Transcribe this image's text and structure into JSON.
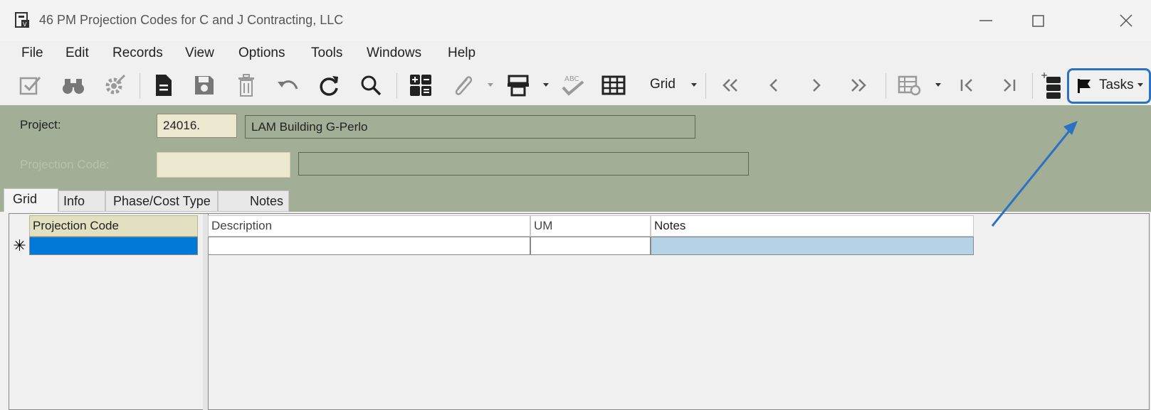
{
  "window": {
    "title": "46 PM Projection Codes for C and J Contracting, LLC",
    "controls": [
      "minimize",
      "maximize",
      "close"
    ]
  },
  "menu": [
    "File",
    "Edit",
    "Records",
    "View",
    "Options",
    "Tools",
    "Windows",
    "Help"
  ],
  "toolbar": {
    "grid_label": "Grid",
    "tasks_label": "Tasks",
    "icons": [
      "validate-icon",
      "binoculars-icon",
      "settings-icon",
      "new-document-icon",
      "save-icon",
      "delete-icon",
      "undo-icon",
      "refresh-icon",
      "search-icon",
      "calculator-icon",
      "attachment-icon",
      "print-icon",
      "spellcheck-icon",
      "grid-icon",
      "first-record-icon",
      "previous-record-icon",
      "next-record-icon",
      "last-record-icon",
      "form-settings-icon",
      "first-page-icon",
      "last-page-icon",
      "add-layer-icon",
      "flag-icon"
    ]
  },
  "header": {
    "project_label": "Project:",
    "project_value": "24016.",
    "project_description": "LAM Building G-Perlo",
    "projection_code_label": "Projection Code:",
    "projection_code_value": "",
    "projection_code_description": ""
  },
  "tabs": [
    "Grid",
    "Info",
    "Phase/Cost Type",
    "Notes"
  ],
  "grid": {
    "frozen_column": "Projection Code",
    "columns": [
      "Description",
      "UM",
      "Notes"
    ],
    "new_row_marker": "✳"
  },
  "colors": {
    "header_bg": "#a3ae97",
    "selected_cell": "#0078d7",
    "notes_cell": "#b4d3e6",
    "tasks_border": "#2a73c4"
  }
}
